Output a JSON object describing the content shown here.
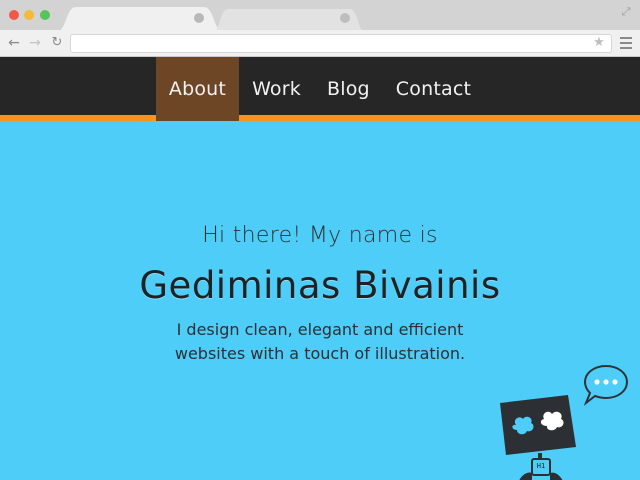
{
  "browser": {
    "url": "",
    "colors": {
      "close": "#f0584c",
      "minimize": "#f6b939",
      "maximize": "#58c35b"
    }
  },
  "site": {
    "nav": {
      "items": [
        {
          "label": "About",
          "active": true
        },
        {
          "label": "Work",
          "active": false
        },
        {
          "label": "Blog",
          "active": false
        },
        {
          "label": "Contact",
          "active": false
        }
      ]
    },
    "hero": {
      "greeting": "Hi there! My name is",
      "name": "Gediminas Bivainis",
      "tagline": "I design clean, elegant and efficient websites with a touch of illustration."
    },
    "robot": {
      "badge": "H1"
    },
    "colors": {
      "background": "#4dcdf8",
      "nav_background": "#262626",
      "nav_active": "#6c4625",
      "nav_accent": "#f7921e"
    }
  }
}
